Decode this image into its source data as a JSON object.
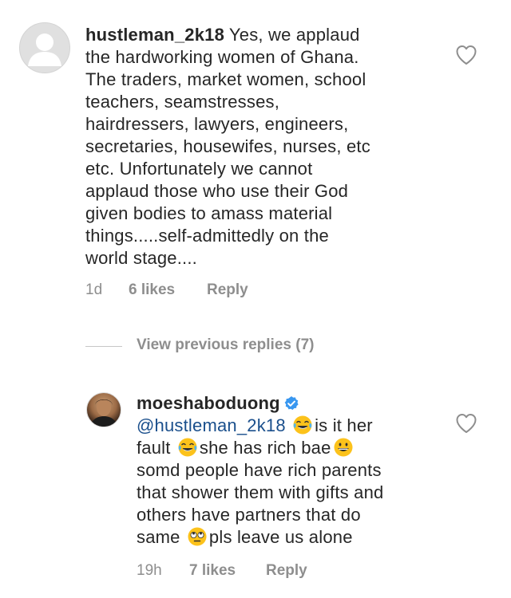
{
  "comment1": {
    "username": "hustleman_2k18",
    "text_lines": [
      "Yes, we applaud",
      "the hardworking women of Ghana.",
      "The traders, market women, school",
      "teachers, seamstresses,",
      "hairdressers, lawyers, engineers,",
      "secretaries, housewifes, nurses, etc",
      "etc. Unfortunately we cannot",
      "applaud those who use their God",
      "given bodies to amass material",
      "things.....self-admittedly on the",
      "world stage...."
    ],
    "time": "1d",
    "likes": "6 likes",
    "reply": "Reply"
  },
  "replies": {
    "label": "View previous replies (7)"
  },
  "comment2": {
    "username": "moeshaboduong",
    "mention": "@hustleman_2k18",
    "seg_after_mention": "is it her",
    "seg_fault": "fault",
    "seg_rich_bae": "she has rich bae",
    "text_lines": [
      "somd people have rich parents",
      "that shower them with gifts and",
      "others have partners that do"
    ],
    "seg_same": "same",
    "seg_leave": "pls leave us alone",
    "time": "19h",
    "likes": "7 likes",
    "reply": "Reply"
  },
  "icons": {
    "heart": "heart-outline-icon",
    "verified": "verified-badge-icon",
    "laugh": "face-with-tears-of-joy-emoji",
    "grin": "grinning-face-emoji",
    "eyeroll": "face-with-rolling-eyes-emoji"
  },
  "colors": {
    "text": "#262626",
    "muted": "#8e8e8e",
    "mention": "#1a4f8c",
    "verified": "#3897f0"
  }
}
